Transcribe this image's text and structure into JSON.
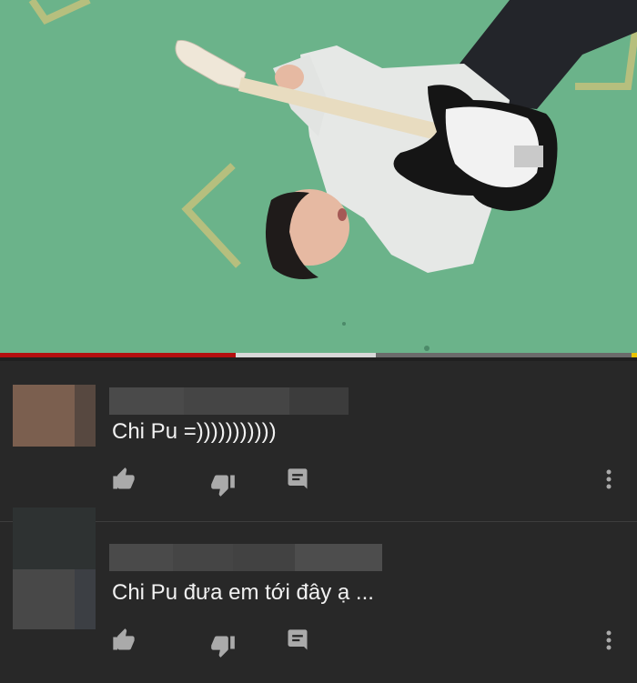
{
  "video": {
    "progress_played": 0.37,
    "progress_buffered": 0.59,
    "colors": {
      "played": "#b40f0f",
      "buffered": "#d8d8d8",
      "background": "#6bb38a"
    }
  },
  "comments": [
    {
      "text": "Chi Pu =)))))))))))",
      "actions": [
        "like-icon",
        "dislike-icon",
        "reply-icon",
        "more-vertical-icon"
      ]
    },
    {
      "text": "Chi Pu đưa em tới đây ạ ...",
      "actions": [
        "like-icon",
        "dislike-icon",
        "reply-icon",
        "more-vertical-icon"
      ]
    }
  ]
}
